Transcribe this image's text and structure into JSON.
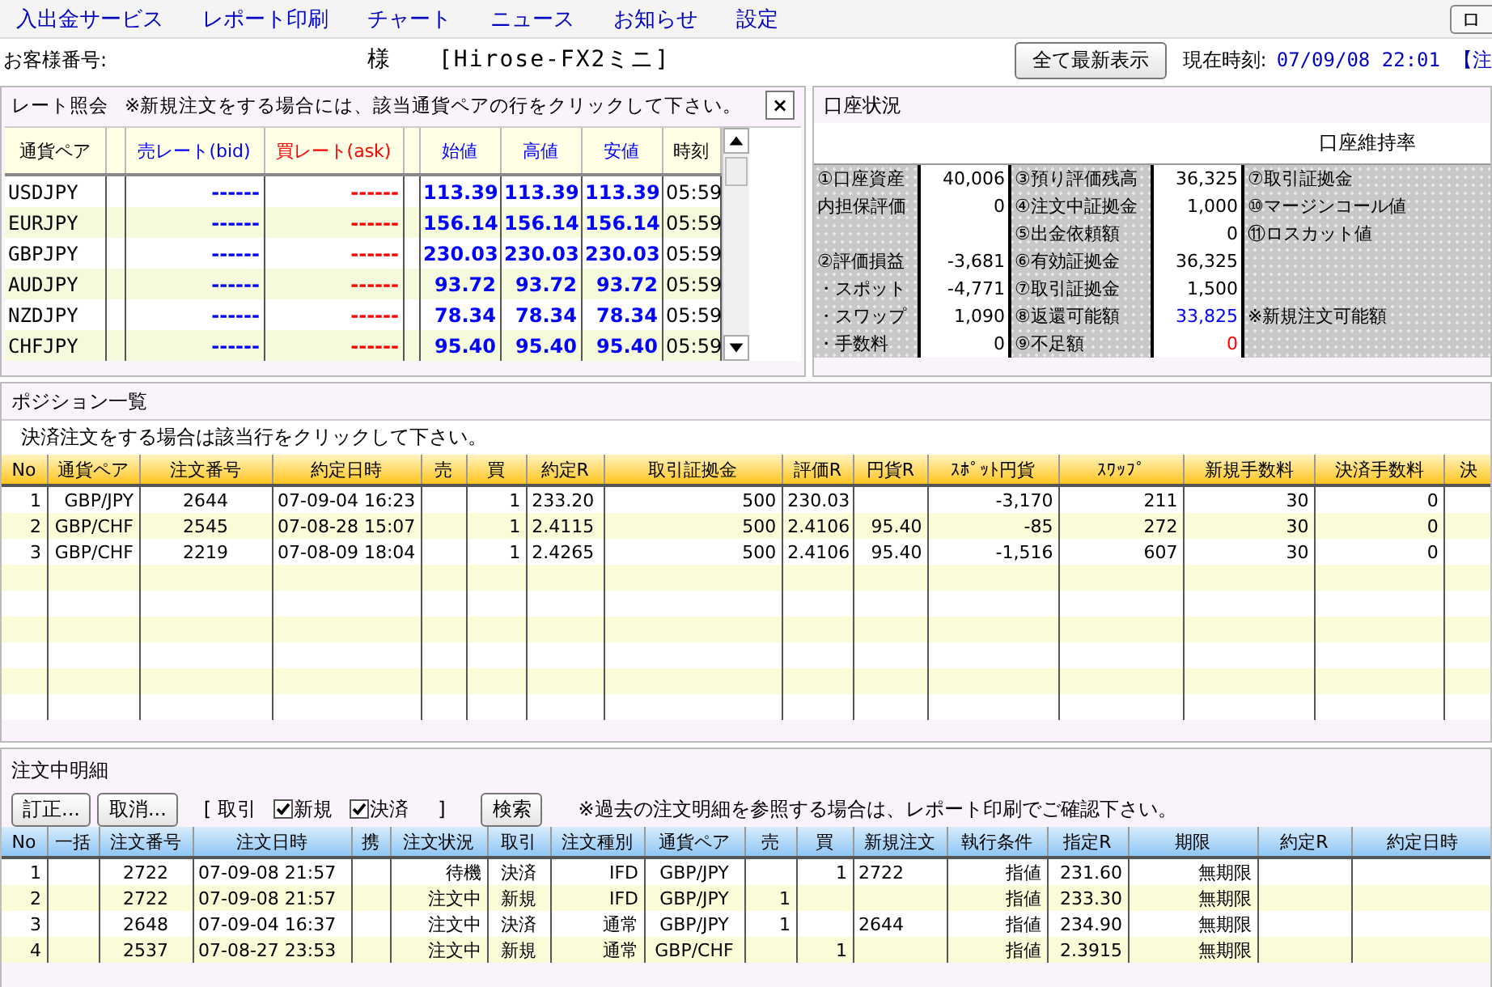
{
  "menu": {
    "items": [
      "入出金サービス",
      "レポート印刷",
      "チャート",
      "ニュース",
      "お知らせ",
      "設定"
    ],
    "edge_button": "ロ"
  },
  "header": {
    "customer_label": "お客様番号:",
    "honorific": "様",
    "account_name": "[Hirose-FX2ミニ]",
    "refresh_button": "全て最新表示",
    "time_label": "現在時刻:",
    "time": "07/09/08 22:01",
    "edge_text": "【注"
  },
  "rates": {
    "title": "レート照会",
    "note": "※新規注文をする場合には、該当通貨ペアの行をクリックして下さい。",
    "close": "×",
    "columns": [
      "通貨ペア",
      "売レート(bid)",
      "買レート(ask)",
      "始値",
      "高値",
      "安値",
      "時刻"
    ],
    "rows": [
      [
        "USDJPY",
        "------",
        "------",
        "113.39",
        "113.39",
        "113.39",
        "05:59"
      ],
      [
        "EURJPY",
        "------",
        "------",
        "156.14",
        "156.14",
        "156.14",
        "05:59"
      ],
      [
        "GBPJPY",
        "------",
        "------",
        "230.03",
        "230.03",
        "230.03",
        "05:59"
      ],
      [
        "AUDJPY",
        "------",
        "------",
        "93.72",
        "93.72",
        "93.72",
        "05:59"
      ],
      [
        "NZDJPY",
        "------",
        "------",
        "78.34",
        "78.34",
        "78.34",
        "05:59"
      ],
      [
        "CHFJPY",
        "------",
        "------",
        "95.40",
        "95.40",
        "95.40",
        "05:59"
      ]
    ]
  },
  "account": {
    "title": "口座状況",
    "ratio_label": "口座維持率",
    "rows": [
      {
        "left_label": "①口座資産",
        "left_value": "40,006",
        "mid_label": "③預り評価残高",
        "mid_value": {
          "text": "36,325"
        },
        "right_label": "⑦取引証拠金"
      },
      {
        "left_label": "内担保評価",
        "left_value": "0",
        "mid_label": "④注文中証拠金",
        "mid_value": {
          "text": "1,000"
        },
        "right_label": "⑩マージンコール値"
      },
      {
        "mid_label": "⑤出金依頼額",
        "mid_value": {
          "text": "0"
        },
        "right_label": "⑪ロスカット値"
      },
      {
        "left_label": "②評価損益",
        "left_value": "-3,681",
        "mid_label": "⑥有効証拠金",
        "mid_value": {
          "text": "36,325"
        }
      },
      {
        "left_label": "・スポット",
        "left_value": "-4,771",
        "mid_label": "⑦取引証拠金",
        "mid_value": {
          "text": "1,500"
        }
      },
      {
        "left_label": "・スワップ",
        "left_value": "1,090",
        "mid_label": "⑧返還可能額",
        "mid_value": {
          "text": "33,825",
          "color": "#0000ff"
        },
        "right_label": "※新規注文可能額"
      },
      {
        "left_label": "・手数料",
        "left_value": "0",
        "mid_label": "⑨不足額",
        "mid_value": {
          "text": "0",
          "color": "#ff0000"
        }
      }
    ]
  },
  "positions": {
    "title": "ポジション一覧",
    "note": "決済注文をする場合は該当行をクリックして下さい。",
    "columns": [
      "No",
      "通貨ペア",
      "注文番号",
      "約定日時",
      "売",
      "買",
      "約定R",
      "取引証拠金",
      "評価R",
      "円貨R",
      "ｽﾎﾟｯﾄ円貨",
      "ｽﾜｯﾌﾟ",
      "新規手数料",
      "決済手数料",
      "決"
    ],
    "rows": [
      [
        "1",
        "GBP/JPY",
        "2644",
        "07-09-04 16:23",
        null,
        "1",
        "233.20",
        "500",
        "230.03",
        null,
        "-3,170",
        "211",
        "30",
        "0",
        null
      ],
      [
        "2",
        "GBP/CHF",
        "2545",
        "07-08-28 15:07",
        null,
        "1",
        "2.4115",
        "500",
        "2.4106",
        "95.40",
        "-85",
        "272",
        "30",
        "0",
        null
      ],
      [
        "3",
        "GBP/CHF",
        "2219",
        "07-08-09 18:04",
        null,
        "1",
        "2.4265",
        "500",
        "2.4106",
        "95.40",
        "-1,516",
        "607",
        "30",
        "0",
        null
      ]
    ]
  },
  "orders": {
    "title": "注文中明細",
    "buttons": [
      "訂正...",
      "取消..."
    ],
    "bracket_open": "[",
    "filter_label": "取引",
    "filters": [
      {
        "label": "新規",
        "checked": true
      },
      {
        "label": "決済",
        "checked": true
      }
    ],
    "bracket_close": "]",
    "search_button": "検索",
    "note": "※過去の注文明細を参照する場合は、レポート印刷でご確認下さい。",
    "columns": [
      "No",
      "一括",
      "注文番号",
      "注文日時",
      "携",
      "注文状況",
      "取引",
      "注文種別",
      "通貨ペア",
      "売",
      "買",
      "新規注文",
      "執行条件",
      "指定R",
      "期限",
      "約定R",
      "約定日時"
    ],
    "rows": [
      [
        "1",
        null,
        "2722",
        "07-09-08 21:57",
        null,
        "待機",
        "決済",
        "IFD",
        "GBP/JPY",
        null,
        "1",
        "2722",
        "指値",
        "231.60",
        "無期限",
        null,
        null
      ],
      [
        "2",
        null,
        "2722",
        "07-09-08 21:57",
        null,
        "注文中",
        "新規",
        "IFD",
        "GBP/JPY",
        "1",
        null,
        null,
        "指値",
        "233.30",
        "無期限",
        null,
        null
      ],
      [
        "3",
        null,
        "2648",
        "07-09-04 16:37",
        null,
        "注文中",
        "決済",
        "通常",
        "GBP/JPY",
        "1",
        null,
        "2644",
        "指値",
        "234.90",
        "無期限",
        null,
        null
      ],
      [
        "4",
        null,
        "2537",
        "07-08-27 23:53",
        null,
        "注文中",
        "新規",
        "通常",
        "GBP/CHF",
        null,
        "1",
        null,
        "指値",
        "2.3915",
        "無期限",
        null,
        null
      ]
    ]
  }
}
